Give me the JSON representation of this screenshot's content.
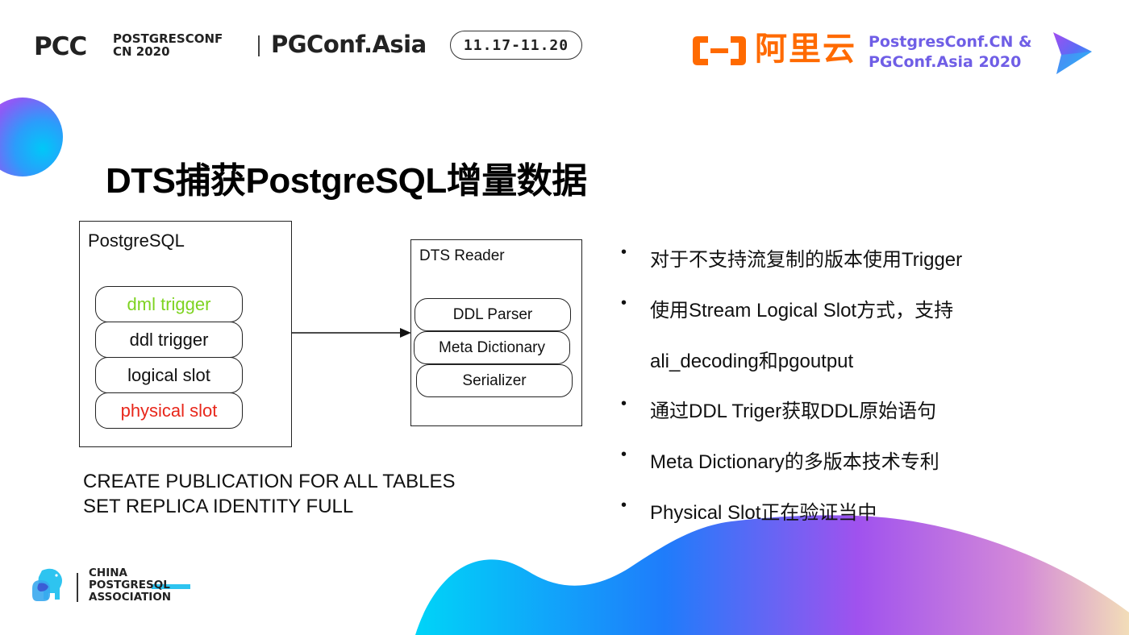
{
  "header": {
    "pcc_logo": "PCC",
    "pcc_sub_line1": "POSTGRESCONF",
    "pcc_sub_line2": "CN 2020",
    "pgconf_logo": "PGConf.Asia",
    "date_range": "11.17-11.20",
    "aliyun_text": "阿里云",
    "conf_line1": "PostgresConf.CN &",
    "conf_line2": "PGConf.Asia 2020"
  },
  "colors": {
    "aliyun_orange": "#ff6a00",
    "conf_purple": "#6f5ee6",
    "dml_green": "#7ed321",
    "physical_red": "#e8271b",
    "gradient_cyan": "#00c8f8",
    "gradient_blue": "#2b7bfb",
    "gradient_purple": "#a052ee",
    "gradient_peach": "#f2ddb8"
  },
  "slide": {
    "title": "DTS捕获PostgreSQL增量数据"
  },
  "diagram": {
    "postgresql_box": {
      "label": "PostgreSQL",
      "components": [
        {
          "label": "dml trigger",
          "color": "#7ed321"
        },
        {
          "label": "ddl trigger",
          "color": "#111111"
        },
        {
          "label": "logical slot",
          "color": "#111111"
        },
        {
          "label": "physical slot",
          "color": "#e8271b"
        }
      ]
    },
    "dts_reader_box": {
      "label": "DTS Reader",
      "components": [
        {
          "label": "DDL Parser"
        },
        {
          "label": "Meta Dictionary"
        },
        {
          "label": "Serializer"
        }
      ]
    },
    "sql_notes": [
      "CREATE PUBLICATION  FOR ALL TABLES",
      "SET REPLICA IDENTITY FULL"
    ]
  },
  "bullets": [
    {
      "dot": "•",
      "text": "对于不支持流复制的版本使用Trigger"
    },
    {
      "dot": "•",
      "text": "使用Stream Logical Slot方式，支持"
    },
    {
      "dot": "",
      "text": "ali_decoding和pgoutput"
    },
    {
      "dot": "•",
      "text": "通过DDL Triger获取DDL原始语句"
    },
    {
      "dot": "•",
      "text": "Meta Dictionary的多版本技术专利"
    },
    {
      "dot": "•",
      "text": "Physical Slot正在验证当中"
    }
  ],
  "footer": {
    "association_line1": "CHINA",
    "association_line2": "POSTGRESQL",
    "association_line3": "ASSOCIATION"
  }
}
